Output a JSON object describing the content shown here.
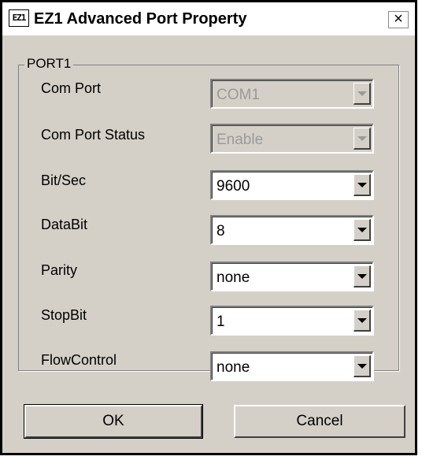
{
  "window": {
    "icon_text": "EZ1",
    "title": "EZ1 Advanced Port Property",
    "close_glyph": "×"
  },
  "group": {
    "title": "PORT1"
  },
  "fields": [
    {
      "label": "Com Port",
      "value": "COM1",
      "enabled": false
    },
    {
      "label": "Com Port Status",
      "value": "Enable",
      "enabled": false
    },
    {
      "label": "Bit/Sec",
      "value": "9600",
      "enabled": true
    },
    {
      "label": "DataBit",
      "value": "8",
      "enabled": true
    },
    {
      "label": "Parity",
      "value": "none",
      "enabled": true
    },
    {
      "label": "StopBit",
      "value": "1",
      "enabled": true
    },
    {
      "label": "FlowControl",
      "value": "none",
      "enabled": true
    }
  ],
  "buttons": {
    "ok": "OK",
    "cancel": "Cancel"
  }
}
